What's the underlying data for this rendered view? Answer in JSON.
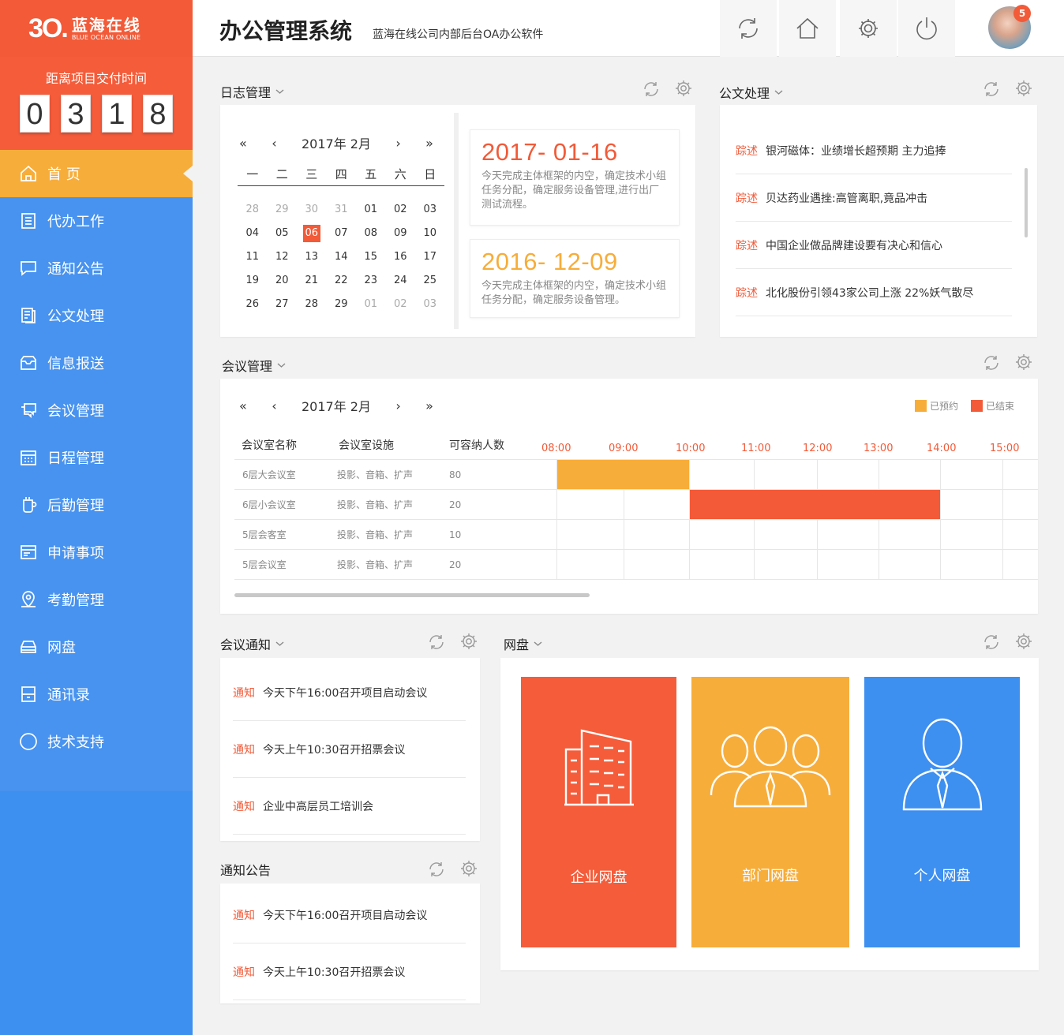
{
  "brand": {
    "mark": "3O.",
    "name_cn": "蓝海在线",
    "name_en": "BLUE OCEAN ONLINE"
  },
  "countdown": {
    "label": "距离项目交付时间",
    "digits": [
      "0",
      "3",
      "1",
      "8"
    ]
  },
  "nav": [
    {
      "label": "首 页",
      "icon": "home-icon",
      "active": true
    },
    {
      "label": "代办工作",
      "icon": "list-icon"
    },
    {
      "label": "通知公告",
      "icon": "chat-icon"
    },
    {
      "label": "公文处理",
      "icon": "document-icon"
    },
    {
      "label": "信息报送",
      "icon": "inbox-icon"
    },
    {
      "label": "会议管理",
      "icon": "meeting-icon"
    },
    {
      "label": "日程管理",
      "icon": "calendar-icon"
    },
    {
      "label": "后勤管理",
      "icon": "cup-icon"
    },
    {
      "label": "申请事项",
      "icon": "form-icon"
    },
    {
      "label": "考勤管理",
      "icon": "location-icon"
    },
    {
      "label": "网盘",
      "icon": "drive-icon"
    },
    {
      "label": "通讯录",
      "icon": "contacts-icon"
    },
    {
      "label": "技术支持",
      "icon": "support-icon"
    }
  ],
  "header": {
    "title": "办公管理系统",
    "subtitle": "蓝海在线公司内部后台OA办公软件",
    "badge": "5"
  },
  "log": {
    "title": "日志管理",
    "calendar": {
      "month": "2017年 2月",
      "weekdays": [
        "一",
        "二",
        "三",
        "四",
        "五",
        "六",
        "日"
      ],
      "days": [
        [
          "28",
          "m"
        ],
        [
          "29",
          "m"
        ],
        [
          "30",
          "m"
        ],
        [
          "31",
          "m"
        ],
        [
          "01",
          ""
        ],
        [
          "02",
          ""
        ],
        [
          "03",
          ""
        ],
        [
          "04",
          ""
        ],
        [
          "05",
          ""
        ],
        [
          "06",
          "sel"
        ],
        [
          "07",
          ""
        ],
        [
          "08",
          ""
        ],
        [
          "09",
          ""
        ],
        [
          "10",
          ""
        ],
        [
          "11",
          ""
        ],
        [
          "12",
          ""
        ],
        [
          "13",
          ""
        ],
        [
          "14",
          ""
        ],
        [
          "15",
          ""
        ],
        [
          "16",
          ""
        ],
        [
          "17",
          ""
        ],
        [
          "19",
          ""
        ],
        [
          "20",
          ""
        ],
        [
          "21",
          ""
        ],
        [
          "22",
          ""
        ],
        [
          "23",
          ""
        ],
        [
          "24",
          ""
        ],
        [
          "25",
          ""
        ],
        [
          "26",
          ""
        ],
        [
          "27",
          ""
        ],
        [
          "28",
          ""
        ],
        [
          "29",
          ""
        ],
        [
          "01",
          "m"
        ],
        [
          "02",
          "m"
        ],
        [
          "03",
          "m"
        ]
      ]
    },
    "notes": [
      {
        "date": "2017- 01-16",
        "color": "#f25a38",
        "text": "今天完成主体框架的内空，确定技术小组任务分配，确定服务设备管理,进行出厂测试流程。"
      },
      {
        "date": "2016- 12-09",
        "color": "#f7ad3a",
        "text": "今天完成主体框架的内空，确定技术小组任务分配，确定服务设备管理。"
      }
    ]
  },
  "docs": {
    "title": "公文处理",
    "items": [
      {
        "tag": "踪述",
        "text": "银河磁体：业绩增长超预期 主力追捧"
      },
      {
        "tag": "踪述",
        "text": "贝达药业遇挫:高管离职,竟品冲击"
      },
      {
        "tag": "踪述",
        "text": "中国企业做品牌建设要有决心和信心"
      },
      {
        "tag": "踪述",
        "text": "北化股份引领43家公司上涨 22%妖气散尽"
      }
    ]
  },
  "meeting": {
    "title": "会议管理",
    "month": "2017年 2月",
    "legend": [
      {
        "label": "已预约",
        "color": "#f7ad3a"
      },
      {
        "label": "已结束",
        "color": "#f25a38"
      }
    ],
    "columns": [
      "会议室名称",
      "会议室设施",
      "可容纳人数"
    ],
    "times": [
      "08:00",
      "09:00",
      "10:00",
      "11:00",
      "12:00",
      "13:00",
      "14:00",
      "15:00"
    ],
    "rooms": [
      {
        "name": "6层大会议室",
        "facility": "投影、音箱、扩声",
        "capacity": "80"
      },
      {
        "name": "6层小会议室",
        "facility": "投影、音箱、扩声",
        "capacity": "20"
      },
      {
        "name": "5层会客室",
        "facility": "投影、音箱、扩声",
        "capacity": "10"
      },
      {
        "name": "5层会议室",
        "facility": "投影、音箱、扩声",
        "capacity": "20"
      }
    ],
    "bookings": [
      {
        "room": 0,
        "start": "08:00",
        "end": "10:00",
        "status": "已预约"
      },
      {
        "room": 1,
        "start": "10:00",
        "end": "14:00",
        "status": "已结束"
      }
    ]
  },
  "meeting_notice": {
    "title": "会议通知",
    "items": [
      {
        "tag": "通知",
        "text": "今天下午16:00召开项目启动会议"
      },
      {
        "tag": "通知",
        "text": "今天上午10:30召开招票会议"
      },
      {
        "tag": "通知",
        "text": "企业中高层员工培训会"
      }
    ]
  },
  "announcements": {
    "title": "通知公告",
    "items": [
      {
        "tag": "通知",
        "text": "今天下午16:00召开项目启动会议"
      },
      {
        "tag": "通知",
        "text": "今天上午10:30召开招票会议"
      }
    ]
  },
  "netdisk": {
    "title": "网盘",
    "tiles": [
      {
        "label": "企业网盘",
        "color": "#f45c3a",
        "icon": "building-icon"
      },
      {
        "label": "部门网盘",
        "color": "#f7ad3a",
        "icon": "group-icon"
      },
      {
        "label": "个人网盘",
        "color": "#3d8ff0",
        "icon": "person-icon"
      }
    ]
  }
}
